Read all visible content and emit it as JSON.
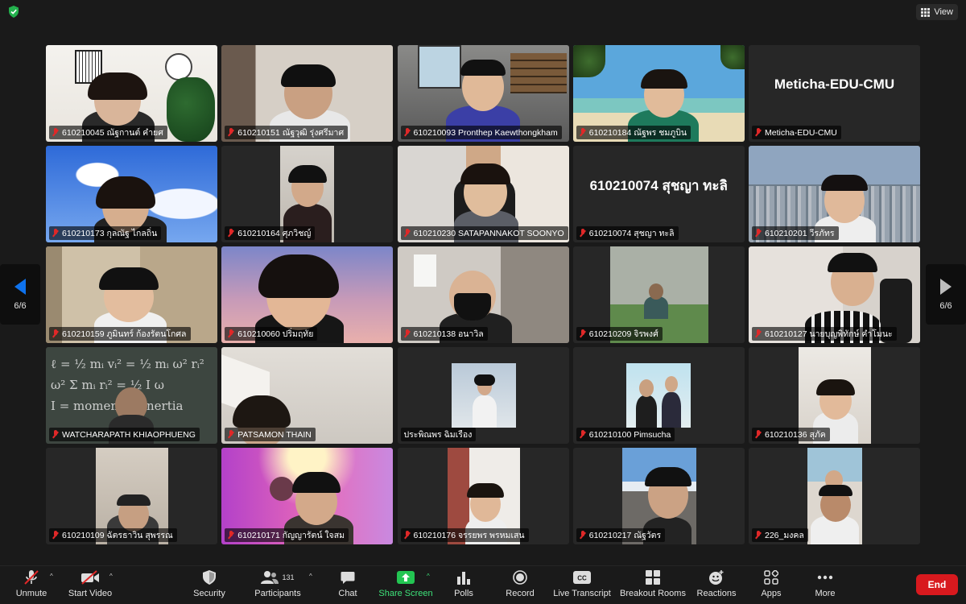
{
  "top": {
    "view_label": "View"
  },
  "pager": {
    "left": "6/6",
    "right": "6/6"
  },
  "tiles": [
    {
      "label": "610210045 ณัฐกานต์ คำยศ"
    },
    {
      "label": "610210151 ณัฐวุฒิ รุ่งศรีมาศ"
    },
    {
      "label": "610210093 Pronthep Kaewthongkham"
    },
    {
      "label": "610210184 ณัฐพร ชมภูบิน"
    },
    {
      "label": "Meticha-EDU-CMU",
      "display_name": "Meticha-EDU-CMU"
    },
    {
      "label": "610210173 กุลณัฐ ไกลถิ่น"
    },
    {
      "label": "610210164 ศุภวิชญ์"
    },
    {
      "label": "610210230 SATAPANNAKOT SOONYO"
    },
    {
      "label": "610210074 สุชญา ทะลิ",
      "display_name": "610210074 สุชญา ทะลิ"
    },
    {
      "label": "610210201 วีรภัทร"
    },
    {
      "label": "610210159 ภูมินทร์ ก้องรัตนโกศล"
    },
    {
      "label": "610210060 ปริ่มฤทัย"
    },
    {
      "label": "610210138 อนาวิล"
    },
    {
      "label": "610210209 จิรพงศ์"
    },
    {
      "label": "610210127 นายบุญพิทักษ์ คำโมนะ"
    },
    {
      "label": "WATCHARAPATH KHIAOPHUENG"
    },
    {
      "label": "PATSAMON THAIN"
    },
    {
      "label": "ประพิณพร ฉิมเรือง"
    },
    {
      "label": "610210100 Pimsucha"
    },
    {
      "label": "610210136 สุภัค"
    },
    {
      "label": "610210109 ฉัตรธาวิน สุพรรณ"
    },
    {
      "label": "610210171 กัญญารัตน์ ใจสม"
    },
    {
      "label": "610210176 จรรยพร พรหมเสน"
    },
    {
      "label": "610210217 ณัฐวัตร"
    },
    {
      "label": "226_มงคล"
    }
  ],
  "toolbar": {
    "unmute": "Unmute",
    "start_video": "Start Video",
    "security": "Security",
    "participants": "Participants",
    "participants_count": "131",
    "chat": "Chat",
    "share_screen": "Share Screen",
    "polls": "Polls",
    "record": "Record",
    "live_transcript": "Live Transcript",
    "breakout_rooms": "Breakout Rooms",
    "reactions": "Reactions",
    "apps": "Apps",
    "more": "More",
    "end": "End"
  },
  "colors": {
    "end": "#d8191e",
    "share": "#23c552",
    "arrow": "#0e72ed",
    "muted": "#e02828"
  }
}
